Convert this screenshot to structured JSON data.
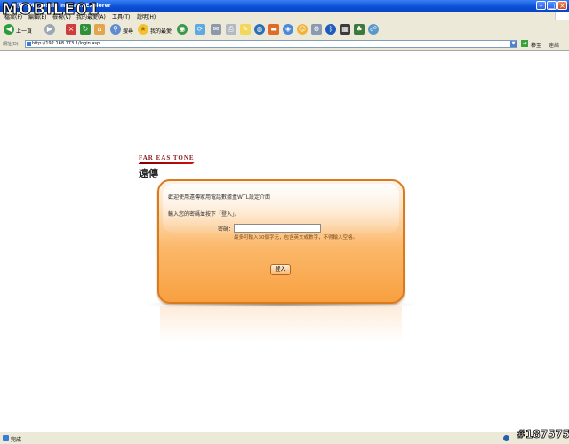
{
  "window": {
    "title": "首頁 - Microsoft Internet Explorer"
  },
  "menubar": {
    "items": [
      "檔案(F)",
      "編輯(E)",
      "檢視(V)",
      "我的最愛(A)",
      "工具(T)",
      "說明(H)"
    ]
  },
  "toolbar": {
    "back_label": "上一頁",
    "search_label": "搜尋",
    "favorites_label": "我的最愛"
  },
  "address": {
    "label": "網址(D)",
    "url": "http://192.168.173.1/login.asp",
    "go_label": "移至",
    "links_label": "連結"
  },
  "page": {
    "logo_text": "FAR EAS TONE",
    "logo_chinese": "遠傳",
    "welcome": "歡迎使用遠傳家用電話數據盒WTL設定介面",
    "instruction": "輸入您的密碼並按下「登入」。",
    "password_label": "密碼：",
    "password_value": "",
    "hint": "最多可輸入30個字元，包含英文或數字，不得輸入空格。",
    "login_button": "登入"
  },
  "statusbar": {
    "text": "完成"
  },
  "watermark": {
    "top": "MOBILE01",
    "bottom": "#187575"
  },
  "colors": {
    "accent": "#f8a040",
    "border": "#d97a1e",
    "titlebar": "#0a4fd6"
  }
}
